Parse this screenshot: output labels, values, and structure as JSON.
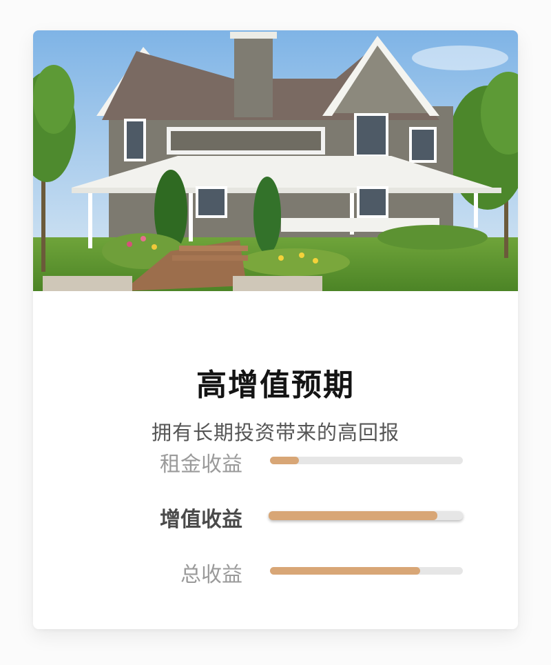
{
  "card": {
    "title": "高增值预期",
    "subtitle": "拥有长期投资带来的高回报"
  },
  "hero_image": {
    "description_icon": "house-photo"
  },
  "colors": {
    "bar_fill": "#d8a676",
    "bar_track": "#e6e6e6",
    "title": "#141414",
    "subtitle": "#555555",
    "label_inactive": "#9a9a9a",
    "label_active": "#4a4a4a"
  },
  "metrics": [
    {
      "label": "租金收益",
      "progress": 0.15,
      "active": false
    },
    {
      "label": "增值收益",
      "progress": 0.87,
      "active": true
    },
    {
      "label": "总收益",
      "progress": 0.78,
      "active": false
    }
  ]
}
